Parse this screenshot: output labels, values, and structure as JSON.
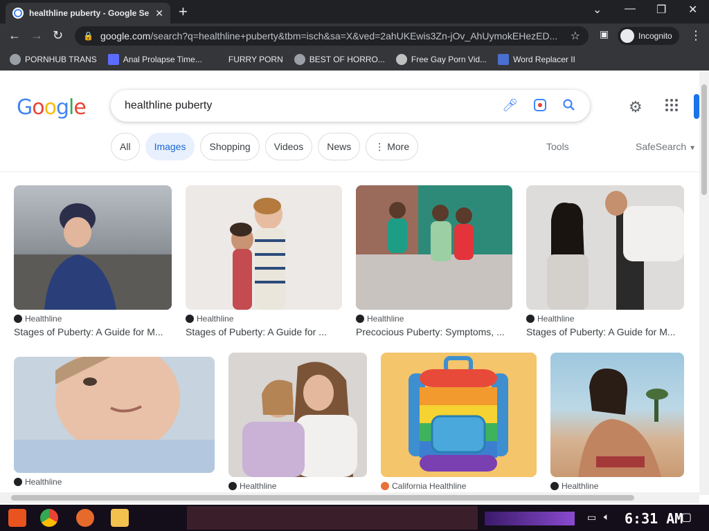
{
  "tab": {
    "title": "healthline puberty - Google Se",
    "close": "✕",
    "new_tab": "+"
  },
  "window_controls": {
    "minimize": "—",
    "restore": "❐",
    "close": "✕",
    "tab_search": "⌄"
  },
  "toolbar": {
    "url_domain": "google.com",
    "url_path": "/search?q=healthline+puberty&tbm=isch&sa=X&ved=2ahUKEwis3Zn-jOv_AhUymokEHezED...",
    "incognito_label": "Incognito",
    "back": "←",
    "forward": "→",
    "reload": "↻",
    "star": "☆",
    "menu": "⋮"
  },
  "bookmarks": [
    {
      "label": "PORNHUB TRANS"
    },
    {
      "label": "Anal Prolapse Time..."
    },
    {
      "label": "FURRY PORN"
    },
    {
      "label": "BEST OF HORRO..."
    },
    {
      "label": "Free Gay Porn Vid..."
    },
    {
      "label": "Word Replacer II"
    }
  ],
  "google": {
    "logo_letters": [
      "G",
      "o",
      "o",
      "g",
      "l",
      "e"
    ],
    "logo_colors": [
      "#4285f4",
      "#ea4335",
      "#fbbc05",
      "#4285f4",
      "#34a853",
      "#ea4335"
    ],
    "query": "healthline puberty",
    "tabs": [
      "All",
      "Images",
      "Shopping",
      "Videos",
      "News",
      "More"
    ],
    "active_tab": "Images",
    "tools": "Tools",
    "safesearch": "SafeSearch"
  },
  "results": [
    {
      "source": "Healthline",
      "caption": "Stages of Puberty: A Guide for M..."
    },
    {
      "source": "Healthline",
      "caption": "Stages of Puberty: A Guide for ..."
    },
    {
      "source": "Healthline",
      "caption": "Precocious Puberty: Symptoms, ..."
    },
    {
      "source": "Healthline",
      "caption": "Stages of Puberty: A Guide for M..."
    },
    {
      "source": "Healthline",
      "caption": ""
    },
    {
      "source": "Healthline",
      "caption": ""
    },
    {
      "source": "California Healthline",
      "caption": ""
    },
    {
      "source": "Healthline",
      "caption": ""
    }
  ],
  "taskbar": {
    "clock": "6:31 AM"
  }
}
